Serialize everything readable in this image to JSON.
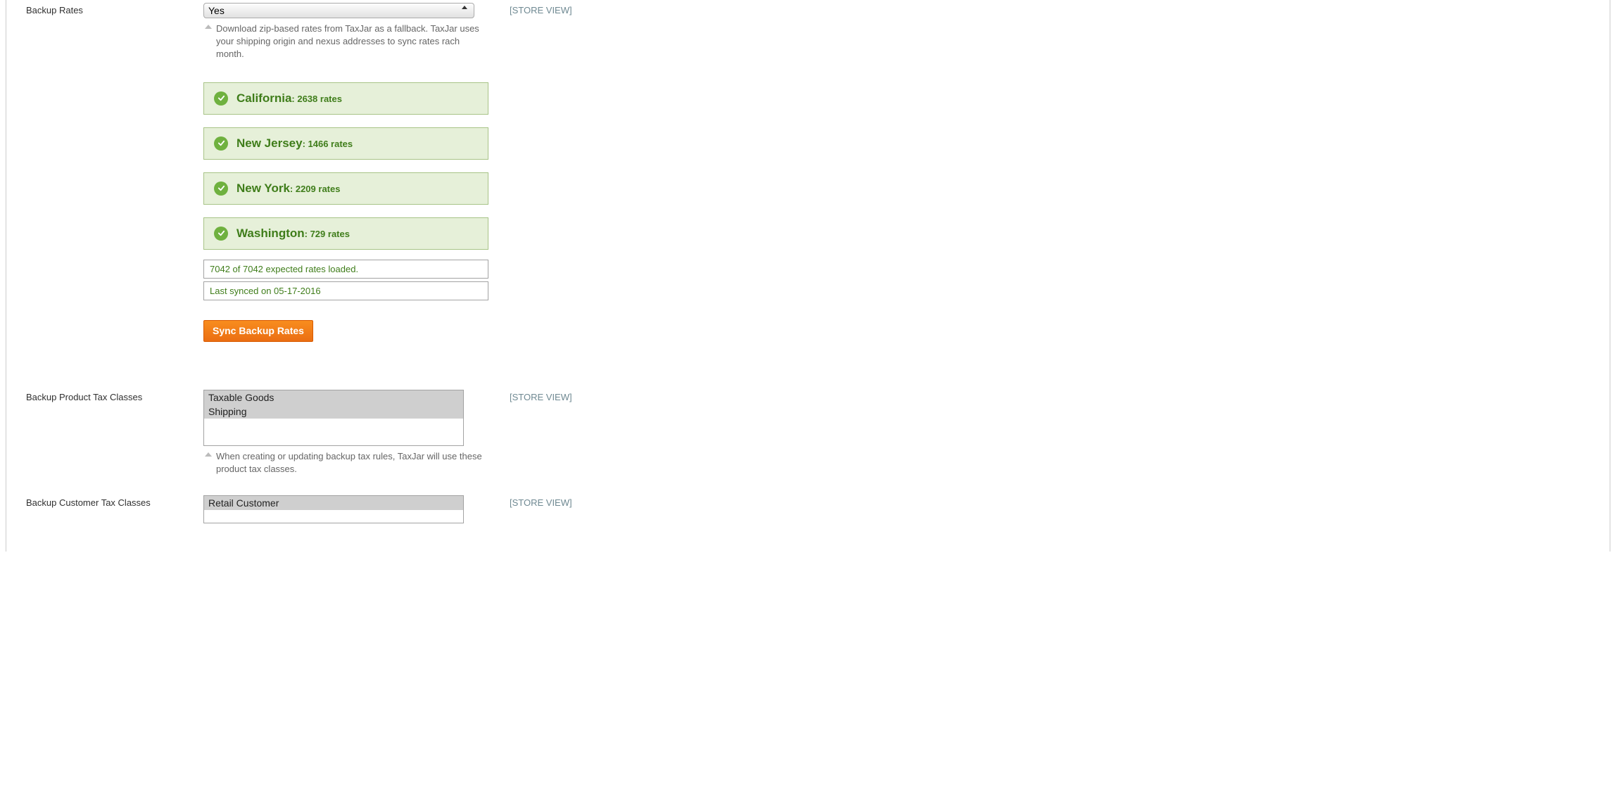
{
  "scope_label": "[STORE VIEW]",
  "backup_rates": {
    "label": "Backup Rates",
    "value": "Yes",
    "note": "Download zip-based rates from TaxJar as a fallback. TaxJar uses your shipping origin and nexus addresses to sync rates rach month.",
    "states": [
      {
        "name": "California",
        "count": 2638,
        "suffix": "rates"
      },
      {
        "name": "New Jersey",
        "count": 1466,
        "suffix": "rates"
      },
      {
        "name": "New York",
        "count": 2209,
        "suffix": "rates"
      },
      {
        "name": "Washington",
        "count": 729,
        "suffix": "rates"
      }
    ],
    "loaded_line": "7042 of 7042 expected rates loaded.",
    "synced_line": "Last synced on 05-17-2016",
    "button": "Sync Backup Rates"
  },
  "product_tax_classes": {
    "label": "Backup Product Tax Classes",
    "options": [
      {
        "text": "Taxable Goods",
        "selected": true
      },
      {
        "text": "Shipping",
        "selected": true
      }
    ],
    "note": "When creating or updating backup tax rules, TaxJar will use these product tax classes."
  },
  "customer_tax_classes": {
    "label": "Backup Customer Tax Classes",
    "options": [
      {
        "text": "Retail Customer",
        "selected": true
      }
    ]
  }
}
